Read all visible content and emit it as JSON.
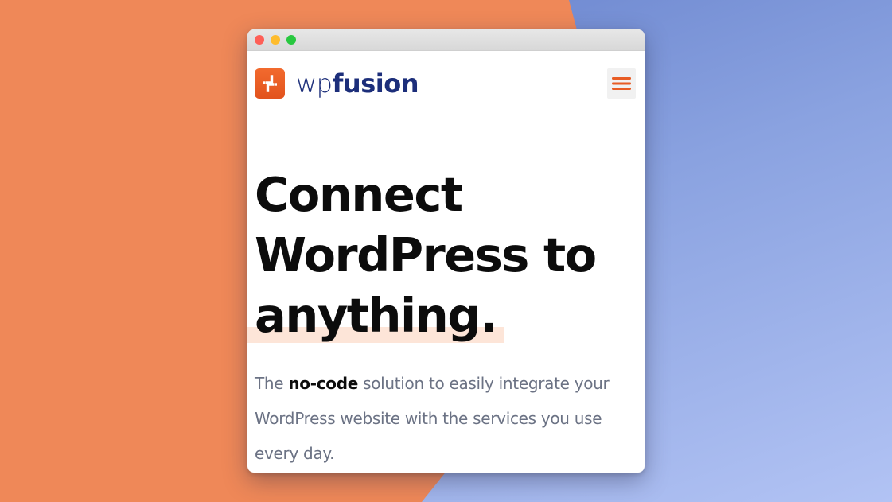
{
  "logo": {
    "text_wp": "wp",
    "text_fusion": "fusion",
    "mark": "wp-fusion-logo-mark-icon"
  },
  "menu": {
    "icon": "hamburger-menu-icon"
  },
  "hero": {
    "headline_line1": "Connect",
    "headline_line2": "WordPress to",
    "headline_highlight": "anything.",
    "subtitle_pre": "The ",
    "subtitle_bold": "no-code",
    "subtitle_post": " solution to easily integrate your WordPress website with the services you use every day."
  },
  "colors": {
    "accent_orange": "#e85c24",
    "brand_navy": "#1c2e7a",
    "highlight": "#fde5d8",
    "background_orange": "#ef8858",
    "background_blue": "#6a86d4"
  }
}
